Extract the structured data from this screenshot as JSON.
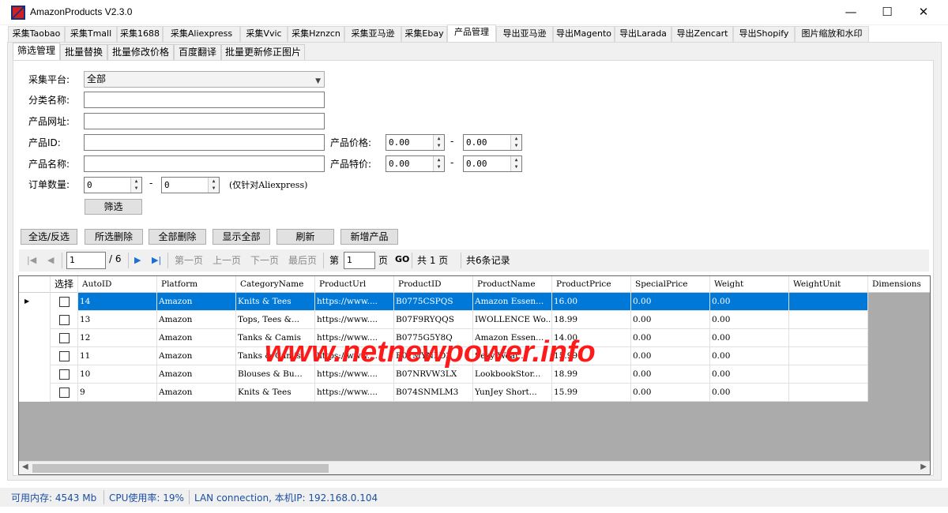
{
  "window": {
    "title": "AmazonProducts V2.3.0",
    "controls": {
      "minimize": "—",
      "maximize": "☐",
      "close": "✕"
    }
  },
  "main_tabs": [
    "采集Taobao",
    "采集Tmall",
    "采集1688",
    "采集Aliexpress",
    "采集Vvic",
    "采集Hznzcn",
    "采集亚马逊",
    "采集Ebay",
    "产品管理",
    "导出亚马逊",
    "导出Magento",
    "导出Larada",
    "导出Zencart",
    "导出Shopify",
    "图片缩放和水印"
  ],
  "active_main_tab": "产品管理",
  "sub_tabs": [
    "筛选管理",
    "批量替换",
    "批量修改价格",
    "百度翻译",
    "批量更新修正图片"
  ],
  "active_sub_tab": "筛选管理",
  "filter": {
    "platform_label": "采集平台:",
    "platform_value": "全部",
    "category_label": "分类名称:",
    "category_value": "",
    "url_label": "产品网址:",
    "url_value": "",
    "id_label": "产品ID:",
    "id_value": "",
    "name_label": "产品名称:",
    "name_value": "",
    "price_label": "产品价格:",
    "price_min": "0.00",
    "price_max": "0.00",
    "special_label": "产品特价:",
    "special_min": "0.00",
    "special_max": "0.00",
    "range_dash": "-",
    "orders_label": "订单数量:",
    "orders_min": "0",
    "orders_max": "0",
    "orders_note": "(仅针对Aliexpress)",
    "filter_button": "筛选"
  },
  "actions": [
    "全选/反选",
    "所选删除",
    "全部删除",
    "显示全部",
    "刷新",
    "新增产品"
  ],
  "pager": {
    "current_page": "1",
    "total_pages": "/ 6",
    "first": "第一页",
    "prev": "上一页",
    "next": "下一页",
    "last": "最后页",
    "goto_prefix": "第",
    "goto_value": "1",
    "goto_suffix": "页",
    "go": "GO",
    "total_pages_text": "共 1 页",
    "total_records": "共6条记录"
  },
  "grid": {
    "columns": [
      "选择",
      "AutoID",
      "Platform",
      "CategoryName",
      "ProductUrl",
      "ProductID",
      "ProductName",
      "ProductPrice",
      "SpecialPrice",
      "Weight",
      "WeightUnit",
      "Dimensions"
    ],
    "rows": [
      {
        "selected": true,
        "AutoID": "14",
        "Platform": "Amazon",
        "CategoryName": "Knits & Tees",
        "ProductUrl": "https://www....",
        "ProductID": "B0775CSPQS",
        "ProductName": "Amazon Essen...",
        "ProductPrice": "16.00",
        "SpecialPrice": "0.00",
        "Weight": "0.00"
      },
      {
        "selected": false,
        "AutoID": "13",
        "Platform": "Amazon",
        "CategoryName": "Tops, Tees &...",
        "ProductUrl": "https://www....",
        "ProductID": "B07F9RYQQS",
        "ProductName": "IWOLLENCE Wo...",
        "ProductPrice": "18.99",
        "SpecialPrice": "0.00",
        "Weight": "0.00"
      },
      {
        "selected": false,
        "AutoID": "12",
        "Platform": "Amazon",
        "CategoryName": "Tanks & Camis",
        "ProductUrl": "https://www....",
        "ProductID": "B0775G5Y8Q",
        "ProductName": "Amazon Essen...",
        "ProductPrice": "14.00",
        "SpecialPrice": "0.00",
        "Weight": "0.00"
      },
      {
        "selected": false,
        "AutoID": "11",
        "Platform": "Amazon",
        "CategoryName": "Tanks & Camis",
        "ProductUrl": "https://www....",
        "ProductID": "B07MYNLD3",
        "ProductName": "Sexy Wear...",
        "ProductPrice": "15.99",
        "SpecialPrice": "0.00",
        "Weight": "0.00"
      },
      {
        "selected": false,
        "AutoID": "10",
        "Platform": "Amazon",
        "CategoryName": "Blouses & Bu...",
        "ProductUrl": "https://www....",
        "ProductID": "B07NRVW3LX",
        "ProductName": "LookbookStor...",
        "ProductPrice": "18.99",
        "SpecialPrice": "0.00",
        "Weight": "0.00"
      },
      {
        "selected": false,
        "AutoID": "9",
        "Platform": "Amazon",
        "CategoryName": "Knits & Tees",
        "ProductUrl": "https://www....",
        "ProductID": "B074SNMLM3",
        "ProductName": "YunJey Short...",
        "ProductPrice": "15.99",
        "SpecialPrice": "0.00",
        "Weight": "0.00"
      }
    ]
  },
  "watermark": "www.netnewpower.info",
  "status": {
    "memory": "可用内存: 4543 Mb",
    "cpu": "CPU使用率: 19%",
    "network": "LAN connection, 本机IP: 192.168.0.104"
  },
  "colors": {
    "selection": "#0078d7",
    "status_text": "#1a4fa3",
    "watermark": "#ff1a1a"
  }
}
